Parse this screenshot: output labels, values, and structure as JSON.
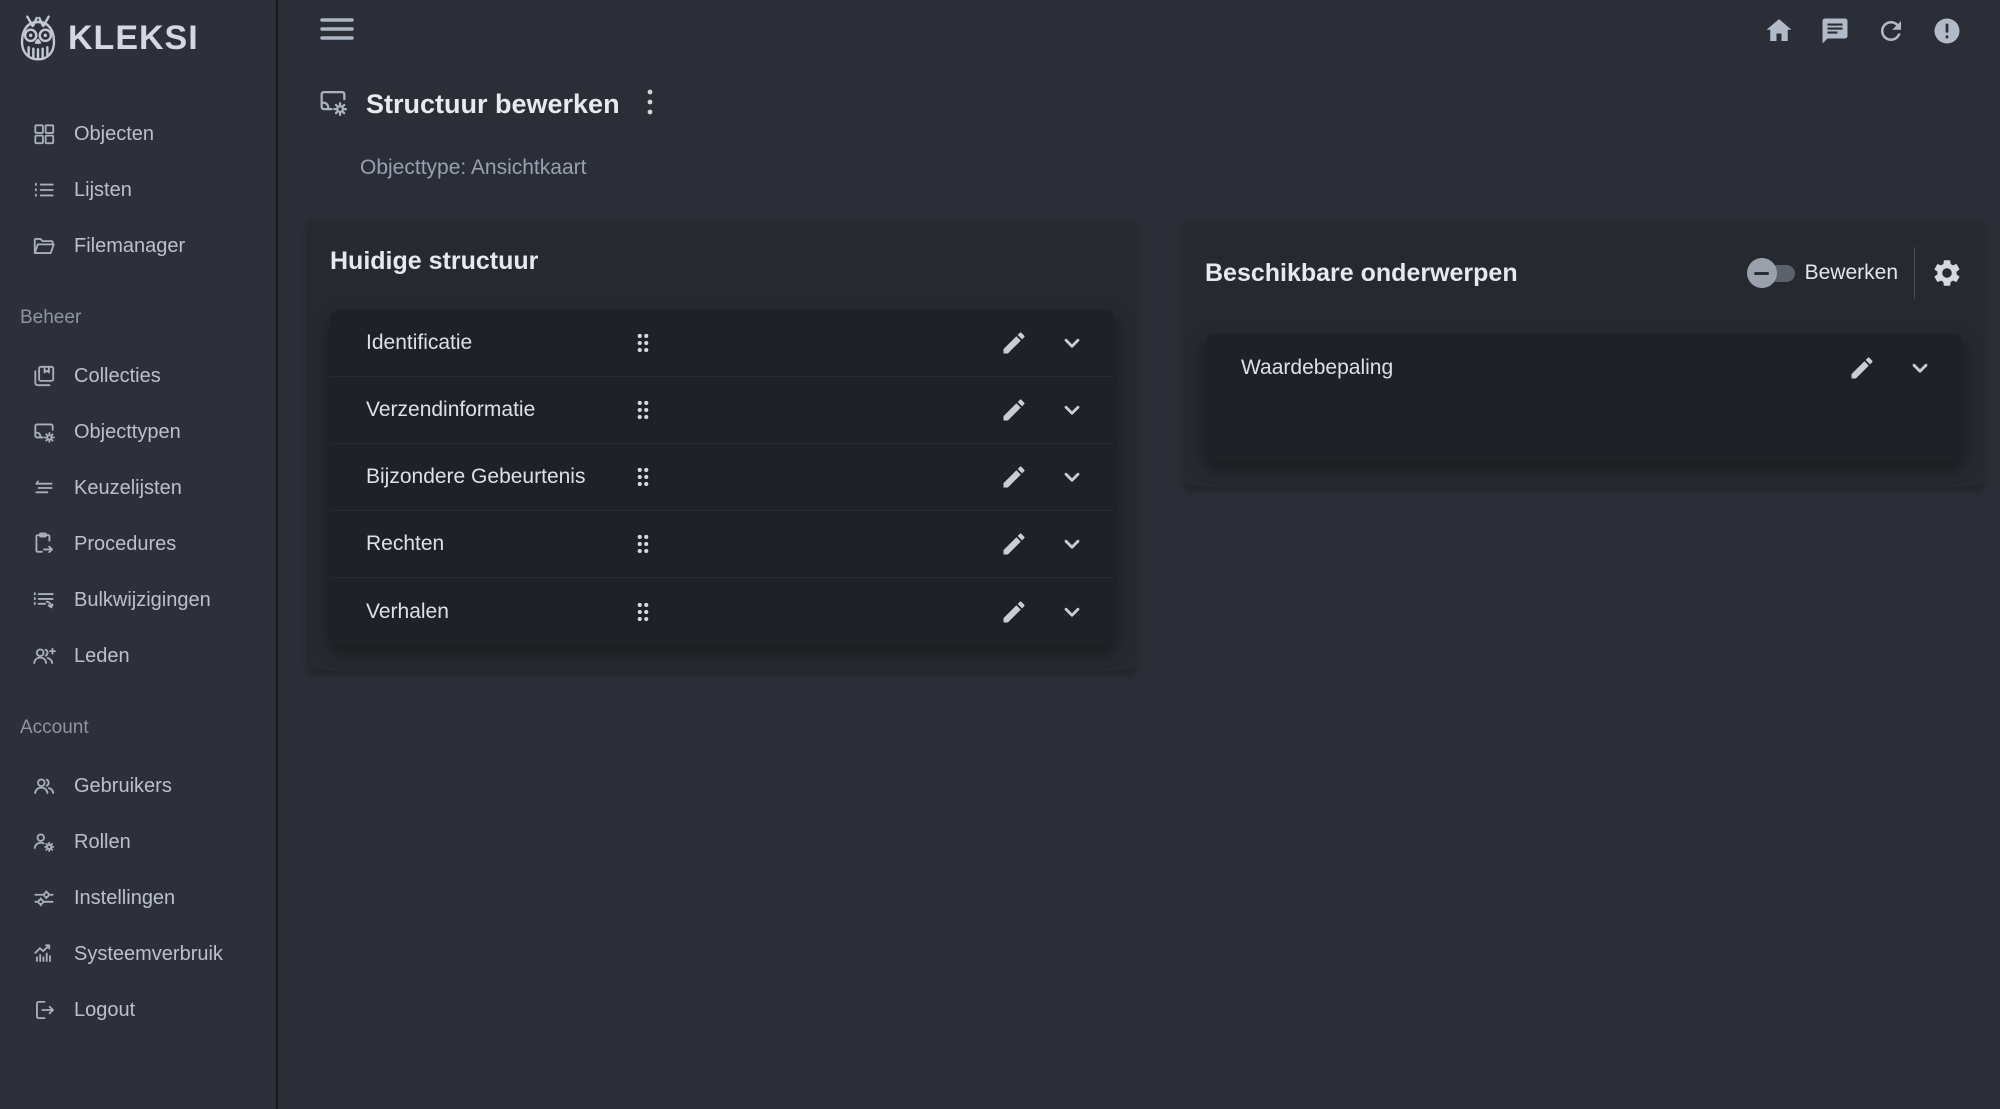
{
  "brand": {
    "name": "KLEKSI",
    "logo_icon": "owl-icon"
  },
  "topbar": {
    "menu_icon": "hamburger-menu-icon",
    "icons": [
      {
        "name": "home-icon"
      },
      {
        "name": "chat-icon"
      },
      {
        "name": "refresh-icon"
      },
      {
        "name": "alert-icon"
      }
    ]
  },
  "page": {
    "title": "Structuur bewerken",
    "title_icon": "objecttype-icon",
    "menu_icon": "kebab-menu-icon",
    "subtitle": "Objecttype: Ansichtkaart"
  },
  "sidebar": {
    "sections": [
      {
        "items": [
          {
            "label": "Objecten",
            "icon": "grid-icon"
          },
          {
            "label": "Lijsten",
            "icon": "list-icon"
          },
          {
            "label": "Filemanager",
            "icon": "folder-icon"
          }
        ]
      },
      {
        "header": "Beheer",
        "items": [
          {
            "label": "Collecties",
            "icon": "collections-icon"
          },
          {
            "label": "Objecttypen",
            "icon": "objecttype-icon"
          },
          {
            "label": "Keuzelijsten",
            "icon": "choice-list-icon"
          },
          {
            "label": "Procedures",
            "icon": "clipboard-arrow-icon"
          },
          {
            "label": "Bulkwijzigingen",
            "icon": "bulk-edit-icon"
          },
          {
            "label": "Leden",
            "icon": "person-add-icon"
          }
        ]
      },
      {
        "header": "Account",
        "items": [
          {
            "label": "Gebruikers",
            "icon": "people-icon"
          },
          {
            "label": "Rollen",
            "icon": "role-gear-icon"
          },
          {
            "label": "Instellingen",
            "icon": "sliders-icon"
          },
          {
            "label": "Systeemverbruik",
            "icon": "usage-chart-icon"
          },
          {
            "label": "Logout",
            "icon": "logout-icon"
          }
        ]
      }
    ]
  },
  "left_panel": {
    "title": "Huidige structuur",
    "rows": [
      "Identificatie",
      "Verzendinformatie",
      "Bijzondere Gebeurtenis",
      "Rechten",
      "Verhalen"
    ]
  },
  "right_panel": {
    "title": "Beschikbare onderwerpen",
    "toggle": {
      "label": "Bewerken",
      "state": "off"
    },
    "rows": [
      "Waardebepaling"
    ]
  },
  "colors": {
    "page_bg": "#2b2e37",
    "sidebar_bg": "#2d3039",
    "card_bg": "#26292f",
    "inner_bg": "#1f2127",
    "text_primary": "#e6e9ee",
    "text_secondary": "#97a1b3",
    "icon": "#b2bac7"
  }
}
